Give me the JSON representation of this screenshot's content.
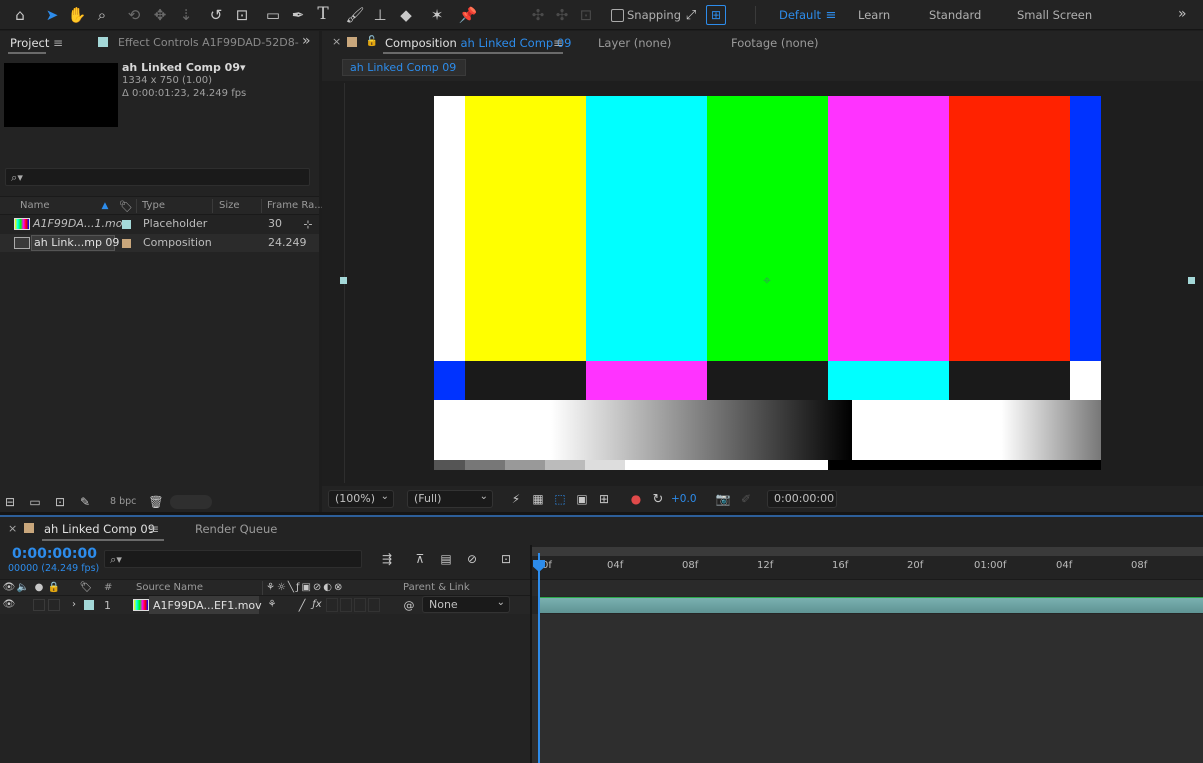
{
  "toolbar": {
    "snapping_label": "Snapping",
    "workspaces": [
      "Default",
      "Learn",
      "Standard",
      "Small Screen"
    ],
    "active_workspace": "Default",
    "more": "»"
  },
  "project": {
    "tab_label": "Project",
    "effect_controls_label": "Effect Controls A1F99DAD-52D8-",
    "more": "»",
    "comp_name": "ah Linked Comp 09▾",
    "comp_size": "1334 x 750 (1.00)",
    "comp_duration": "Δ 0:00:01:23, 24.249 fps",
    "columns": {
      "name": "Name",
      "type": "Type",
      "size": "Size",
      "frame_rate": "Frame Ra..."
    },
    "items": [
      {
        "name": "A1F99DA...1.mov",
        "type": "Placeholder",
        "frame_rate": "30",
        "color": "#a4d8d8"
      },
      {
        "name": "ah Link...mp 09",
        "type": "Composition",
        "frame_rate": "24.249",
        "color": "#c9a77c"
      }
    ],
    "bpc": "8 bpc"
  },
  "viewer": {
    "comp_tab_prefix": "Composition",
    "comp_tab_name": "ah Linked Comp 09",
    "layer_tab": "Layer (none)",
    "footage_tab": "Footage (none)",
    "breadcrumb": "ah Linked Comp 09",
    "zoom": "(100%)",
    "resolution": "(Full)",
    "exposure": "+0.0",
    "timecode": "0:00:00:00"
  },
  "timeline": {
    "tab_label": "ah Linked Comp 09",
    "render_queue_label": "Render Queue",
    "current_time": "0:00:00:00",
    "frames_info": "00000 (24.249 fps)",
    "columns": {
      "num": "#",
      "source_name": "Source Name",
      "parent": "Parent & Link"
    },
    "ruler_labels": [
      "0f",
      "04f",
      "08f",
      "12f",
      "16f",
      "20f",
      "01:00f",
      "04f",
      "08f"
    ],
    "layer": {
      "num": "1",
      "name": "A1F99DA...EF1.mov",
      "parent": "None"
    }
  },
  "colors": {
    "accent": "#2d8ceb",
    "track": "#6fa0a0",
    "placeholder_label": "#a4d8d8",
    "comp_label": "#c9a77c"
  }
}
